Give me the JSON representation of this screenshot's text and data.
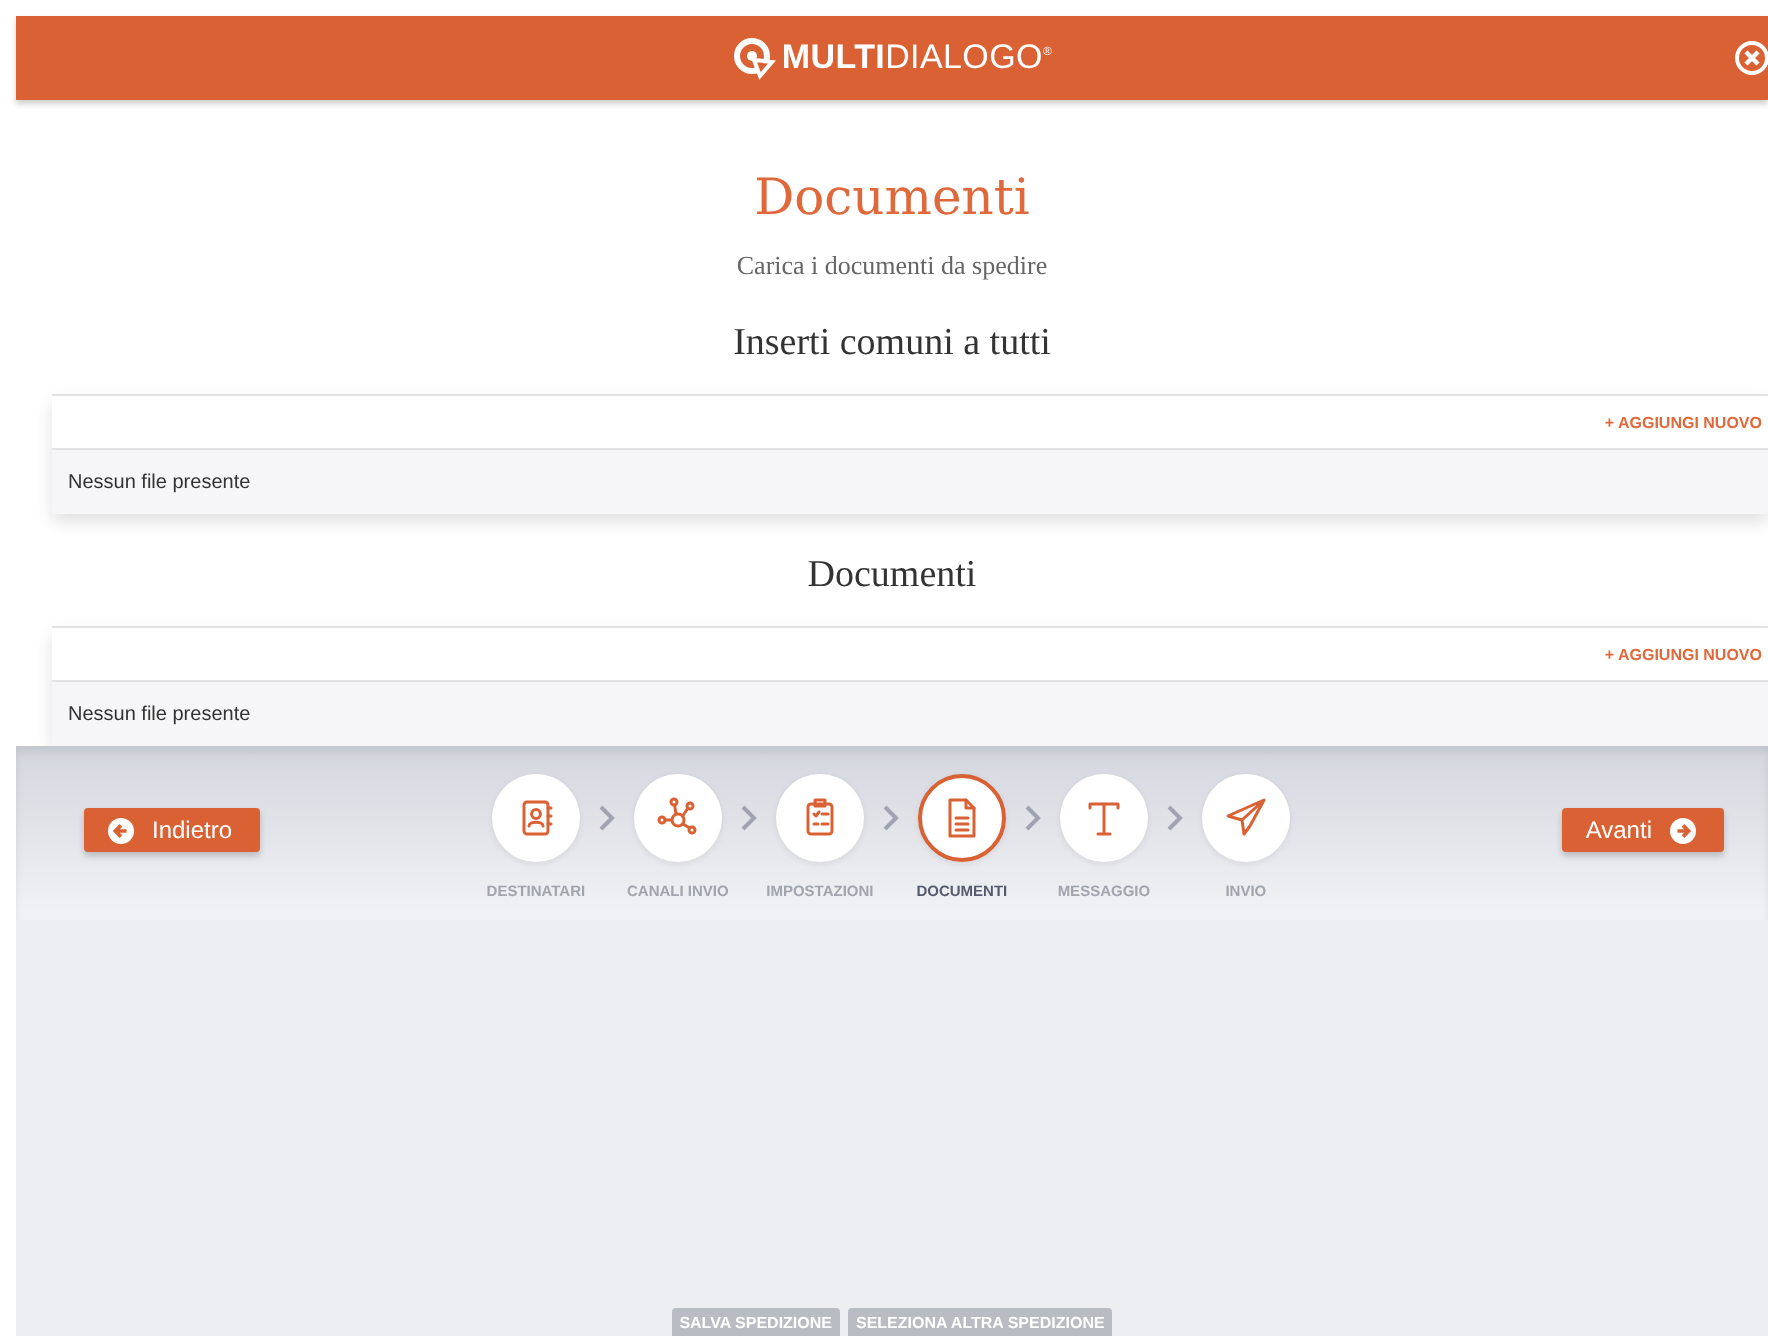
{
  "header": {
    "logo": "**MULTI**DIALOGO$^{®}$"
  },
  "page": {
    "title": "Documenti",
    "subtitle": "Carica i documenti da spedire"
  },
  "sections": [
    {
      "title": "Inserti comuni a tutti",
      "action": "+ AGGIUNGI NUOVO",
      "empty": "Nessun file presente"
    },
    {
      "title": "Documenti",
      "action": "+ AGGIUNGI NUOVO",
      "empty": "Nessun file presente"
    }
  ],
  "footer": {
    "back": "Indietro",
    "next": "Avanti",
    "steps": [
      {
        "kind": "contacts",
        "label": "DESTINATARI",
        "selected": false
      },
      {
        "kind": "network",
        "label": "CANALI INVIO",
        "selected": false
      },
      {
        "kind": "clipboard",
        "label": "IMPOSTAZIONI",
        "selected": false
      },
      {
        "kind": "document",
        "label": "DOCUMENTI",
        "selected": true
      },
      {
        "kind": "text",
        "label": "MESSAGGIO",
        "selected": false
      },
      {
        "kind": "plane",
        "label": "INVIO",
        "selected": false
      }
    ]
  },
  "bottom_bar": {
    "buttons": [
      "SALVA SPEDIZIONE",
      "SELEZIONA ALTRA SPEDIZIONE"
    ]
  }
}
